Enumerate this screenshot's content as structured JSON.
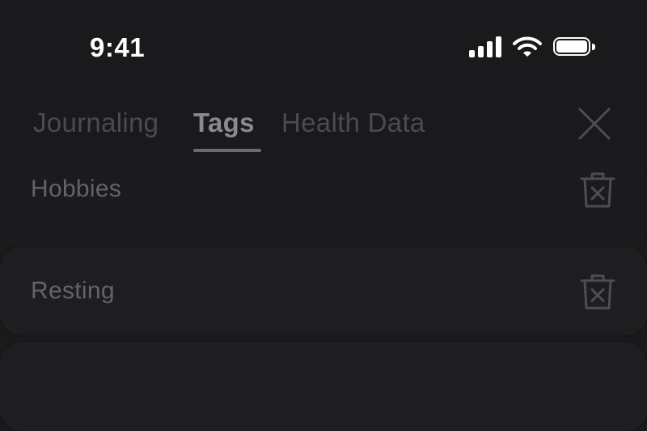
{
  "status_bar": {
    "time": "9:41",
    "icons": [
      "cellular-signal-icon",
      "wifi-icon",
      "battery-icon"
    ]
  },
  "tabs": [
    {
      "label": "Journaling",
      "active": false
    },
    {
      "label": "Tags",
      "active": true
    },
    {
      "label": "Health Data",
      "active": false
    }
  ],
  "header": {
    "close_icon": "close-icon"
  },
  "tags": [
    {
      "label": "Hobbies",
      "action_icon": "trash-icon"
    },
    {
      "label": "Resting",
      "action_icon": "trash-icon"
    }
  ],
  "colors": {
    "background": "#1a191b",
    "card": "#1e1d20",
    "inactive_tab": "#4c4b50",
    "active_tab": "#8a898e",
    "tag_text": "#646368"
  }
}
